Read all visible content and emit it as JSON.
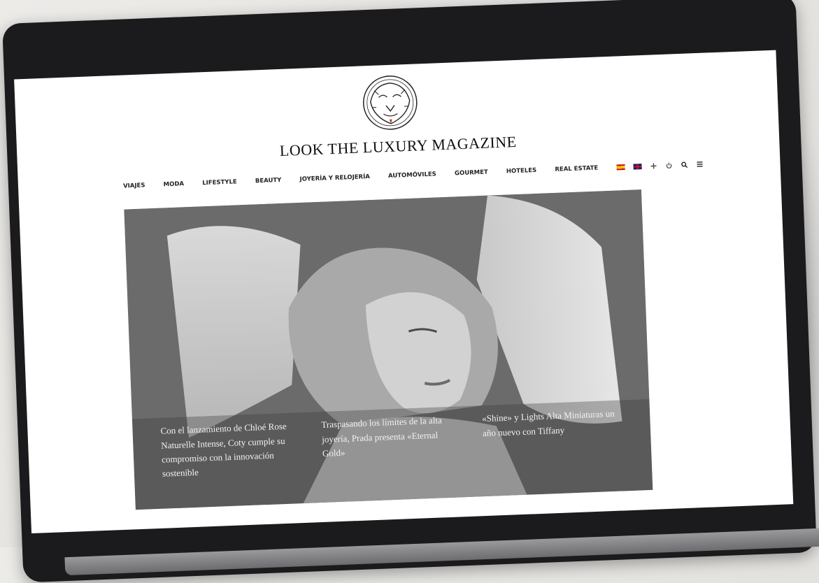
{
  "site": {
    "brand": "LOOK THE LUXURY MAGAZINE"
  },
  "nav": {
    "items": [
      "VIAJES",
      "MODA",
      "LIFESTYLE",
      "BEAUTY",
      "JOYERÍA Y RELOJERÍA",
      "AUTOMÓVILES",
      "GOURMET",
      "HOTELES",
      "REAL ESTATE"
    ],
    "tools": [
      "es-flag-icon",
      "uk-flag-icon",
      "plus-icon",
      "power-icon",
      "search-icon",
      "menu-icon"
    ]
  },
  "hero": {
    "captions": [
      "Con el lanzamiento de Chloé Rose Naturelle Intense, Coty cumple su compromiso con la innovación sostenible",
      "Traspasando los límites de la alta joyería, Prada presenta «Eternal Gold»",
      "«Shine» y Lights Alta Miniaturas un año nuevo con Tiffany"
    ]
  },
  "colors": {
    "accent": "#c0392b",
    "text": "#111111",
    "frame": "#1b1b1d"
  }
}
